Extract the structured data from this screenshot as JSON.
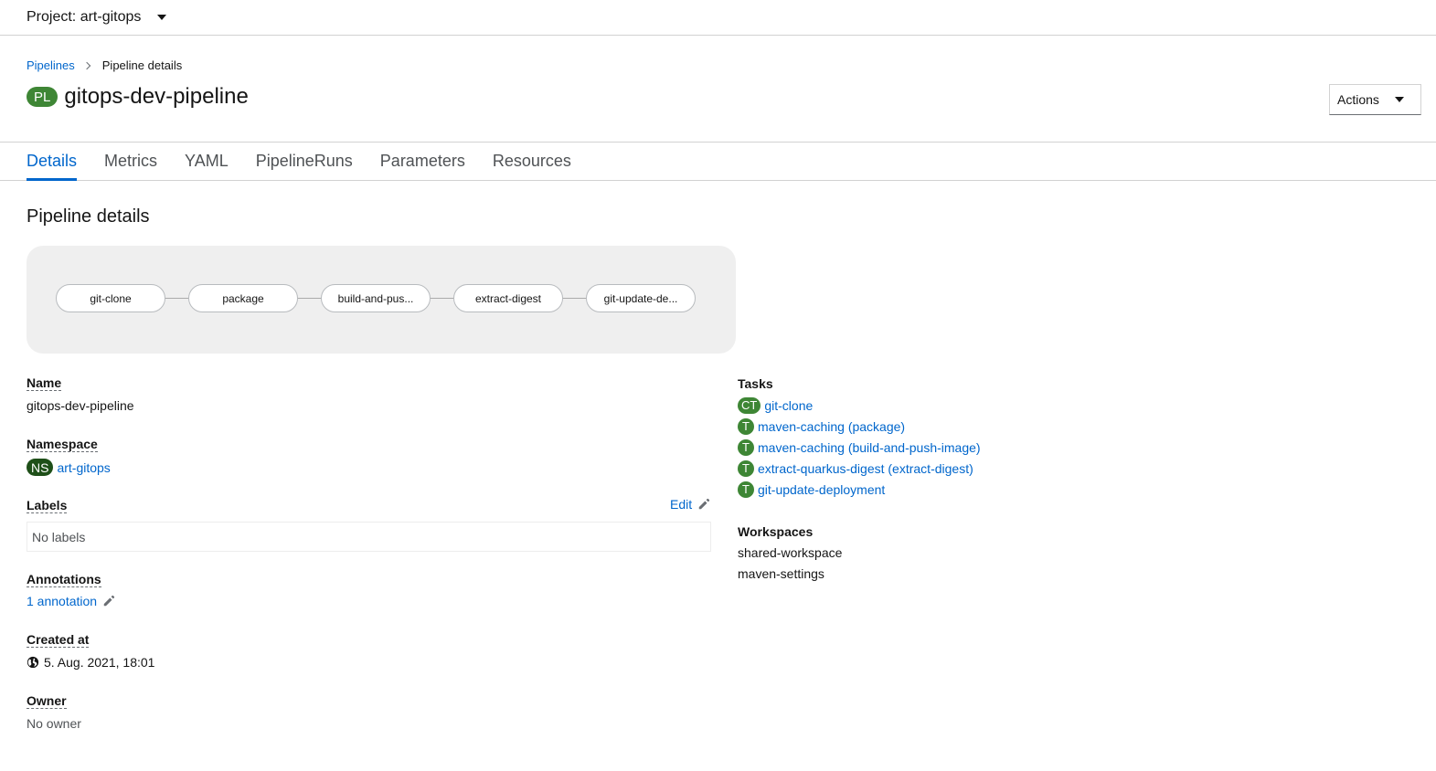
{
  "project": {
    "label": "Project: art-gitops"
  },
  "breadcrumb": {
    "parent": "Pipelines",
    "current": "Pipeline details"
  },
  "header": {
    "badge": "PL",
    "title": "gitops-dev-pipeline",
    "actions_label": "Actions"
  },
  "tabs": [
    {
      "label": "Details",
      "active": true
    },
    {
      "label": "Metrics"
    },
    {
      "label": "YAML"
    },
    {
      "label": "PipelineRuns"
    },
    {
      "label": "Parameters"
    },
    {
      "label": "Resources"
    }
  ],
  "section_title": "Pipeline details",
  "graph": {
    "nodes": [
      "git-clone",
      "package",
      "build-and-pus...",
      "extract-digest",
      "git-update-de..."
    ]
  },
  "details": {
    "name_label": "Name",
    "name_value": "gitops-dev-pipeline",
    "namespace_label": "Namespace",
    "namespace_badge": "NS",
    "namespace_value": "art-gitops",
    "labels_label": "Labels",
    "labels_edit": "Edit",
    "labels_empty": "No labels",
    "annotations_label": "Annotations",
    "annotations_value": "1 annotation",
    "created_label": "Created at",
    "created_value": "5. Aug. 2021, 18:01",
    "owner_label": "Owner",
    "owner_value": "No owner"
  },
  "tasks": {
    "label": "Tasks",
    "items": [
      {
        "badge": "CT",
        "name": "git-clone"
      },
      {
        "badge": "T",
        "name": "maven-caching (package)"
      },
      {
        "badge": "T",
        "name": "maven-caching (build-and-push-image)"
      },
      {
        "badge": "T",
        "name": "extract-quarkus-digest (extract-digest)"
      },
      {
        "badge": "T",
        "name": "git-update-deployment"
      }
    ]
  },
  "workspaces": {
    "label": "Workspaces",
    "items": [
      "shared-workspace",
      "maven-settings"
    ]
  }
}
